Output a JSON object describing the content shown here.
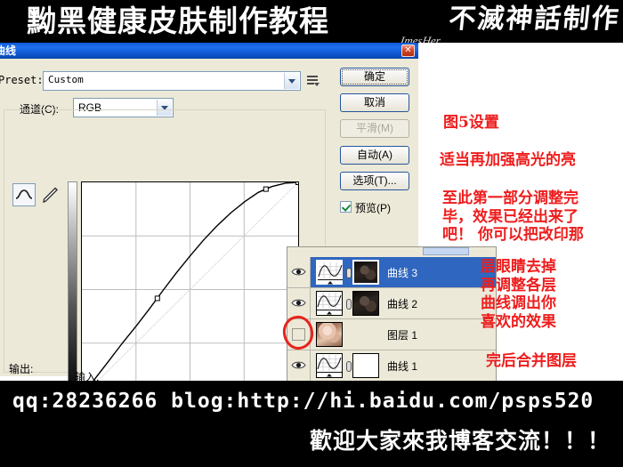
{
  "banner": {
    "title": "黝黑健康皮肤制作教程",
    "watermark": "不滅神話制作",
    "watermark_signature": "ImesHer",
    "badge_icon": "warning-icon"
  },
  "dialog": {
    "title": "曲线",
    "close_icon": "close-icon",
    "preset": {
      "label": "Preset:",
      "value": "Custom",
      "menu_icon": "preset-menu-icon"
    },
    "channel": {
      "label": "通道(C):",
      "value": "RGB"
    },
    "tools": {
      "curve_icon": "curve-tool-icon",
      "pencil_icon": "pencil-tool-icon"
    },
    "axis": {
      "output_label": "输出:",
      "input_label": "输入:"
    },
    "buttons": {
      "ok": "确定",
      "cancel": "取消",
      "smooth": "平滑(M)",
      "auto": "自动(A)",
      "options": "选项(T)..."
    },
    "preview": {
      "label": "预览(P)",
      "checked": true
    }
  },
  "chart_data": {
    "type": "line",
    "title": "曲线",
    "xlabel": "输入:",
    "ylabel": "输出:",
    "xlim": [
      0,
      255
    ],
    "ylim": [
      0,
      255
    ],
    "grid": true,
    "grid_divisions": 4,
    "series": [
      {
        "name": "baseline",
        "style": "diagonal-reference",
        "x": [
          0,
          255
        ],
        "y": [
          0,
          255
        ]
      },
      {
        "name": "RGB",
        "style": "curve",
        "control_points": [
          {
            "input": 0,
            "output": 0
          },
          {
            "input": 89,
            "output": 117
          },
          {
            "input": 217,
            "output": 247
          },
          {
            "input": 255,
            "output": 255
          }
        ],
        "x": [
          0,
          16,
          32,
          48,
          64,
          80,
          96,
          112,
          128,
          144,
          160,
          176,
          192,
          208,
          224,
          240,
          255
        ],
        "y": [
          0,
          22,
          43,
          64,
          84,
          105,
          127,
          148,
          168,
          187,
          204,
          219,
          232,
          243,
          250,
          254,
          255
        ]
      }
    ]
  },
  "layers_panel": {
    "rows": [
      {
        "name": "曲线 3",
        "visible": true,
        "selected": true,
        "kind": "curve",
        "mask": "photo-dark"
      },
      {
        "name": "曲线 2",
        "visible": true,
        "selected": false,
        "kind": "curve",
        "mask": "photo-dark"
      },
      {
        "name": "图层 1",
        "visible": false,
        "selected": false,
        "kind": "photo",
        "mask": ""
      },
      {
        "name": "曲线 1",
        "visible": true,
        "selected": false,
        "kind": "curve",
        "mask": "white"
      }
    ],
    "eye_icon": "eye-icon",
    "link_icon": "link-icon",
    "highlight_color": "#2f66bf"
  },
  "annotations": {
    "color": "#ee1d1d",
    "circle_icon": "red-circle-annotation",
    "note1": "图5设置",
    "note2": "适当再加强高光的亮",
    "note3": "至此第一部分调整完\n毕，效果已经出来了\n吧！ 你可以把改印那",
    "note4": "层眼睛去掉\n再调整各层\n曲线调出你\n喜欢的效果",
    "note5": "完后合并图层"
  },
  "footer": {
    "line1": "qq:28236266  blog:http://hi.baidu.com/psps520",
    "line2": "歡迎大家來我博客交流！！！"
  }
}
